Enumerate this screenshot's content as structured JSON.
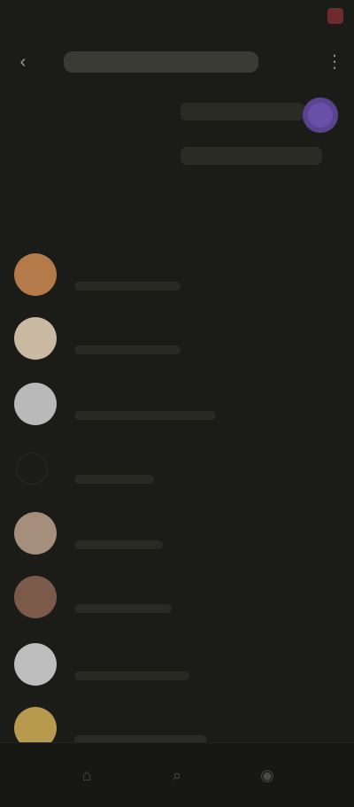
{
  "status": {
    "left": "",
    "right": ""
  },
  "topbar": {
    "back_icon": "back-icon",
    "title": "",
    "more_icon": "more-icon"
  },
  "meta": {
    "label1": "",
    "value1": "",
    "label2": "",
    "value2": "",
    "badge_color": "#6a4fa9"
  },
  "section": {
    "title": ""
  },
  "items": [
    {
      "name": "",
      "avatar_color": "#b57a4a"
    },
    {
      "name": "",
      "avatar_color": "#c9b8a2"
    },
    {
      "name": "",
      "avatar_color": "#b9b9b9"
    },
    {
      "name": "",
      "avatar_color": "#1b1b17"
    },
    {
      "name": "",
      "avatar_color": "#a58e7b"
    },
    {
      "name": "",
      "avatar_color": "#7c5a4a"
    },
    {
      "name": "",
      "avatar_color": "#bdbdbd"
    },
    {
      "name": "",
      "avatar_color": "#b89a4e"
    }
  ],
  "bottom_nav": {
    "items": [
      "home-icon",
      "search-icon",
      "profile-icon"
    ]
  }
}
